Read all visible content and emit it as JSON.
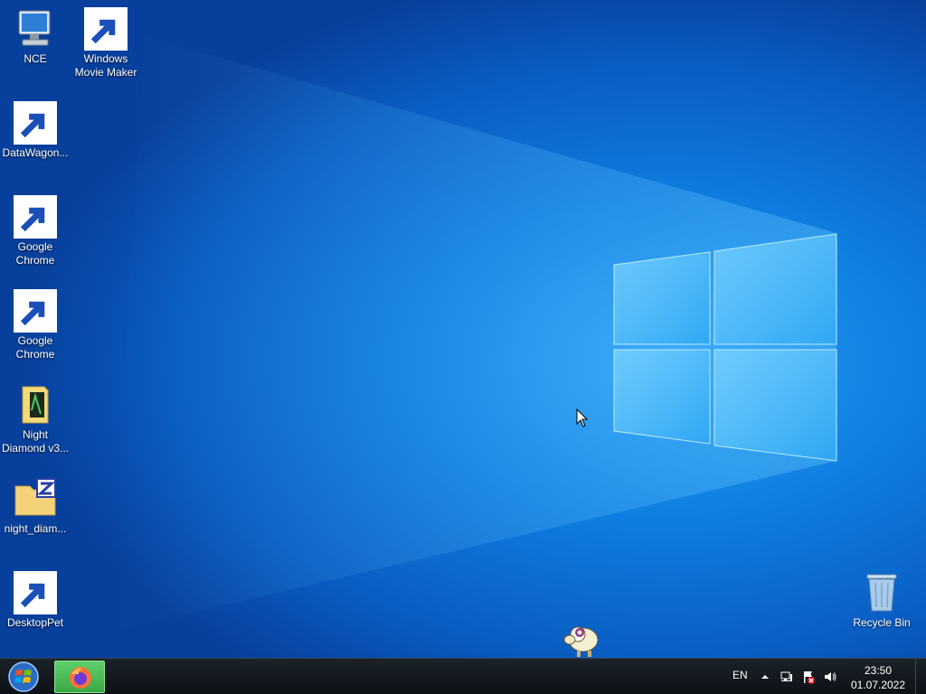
{
  "desktop": {
    "icons": [
      {
        "label": "NCE",
        "icon": "computer-icon"
      },
      {
        "label": "Windows Movie Maker",
        "icon": "movie-maker-icon"
      },
      {
        "label": "DataWagon...",
        "icon": "gear-icon"
      },
      {
        "label": "Google Chrome",
        "icon": "chrome-icon"
      },
      {
        "label": "Google Chrome",
        "icon": "chrome-icon"
      },
      {
        "label": "Night Diamond v3...",
        "icon": "folder-icon"
      },
      {
        "label": "night_diam...",
        "icon": "zip-folder-icon"
      },
      {
        "label": "DesktopPet",
        "icon": "sheep-icon"
      },
      {
        "label": "Recycle Bin",
        "icon": "recycle-bin-icon"
      }
    ]
  },
  "taskbar": {
    "start_icon": "windows-orb-icon",
    "pinned_app_icon": "firefox-icon",
    "language": "EN",
    "tray_icons": [
      "chevron-up-icon",
      "network-icon",
      "action-center-flag-icon",
      "volume-icon"
    ],
    "time": "23:50",
    "date": "01.07.2022"
  },
  "colors": {
    "desktop_blue": "#0f7ee0",
    "taskbar_dark": "#12181e",
    "active_app_green": "#3aa845"
  }
}
